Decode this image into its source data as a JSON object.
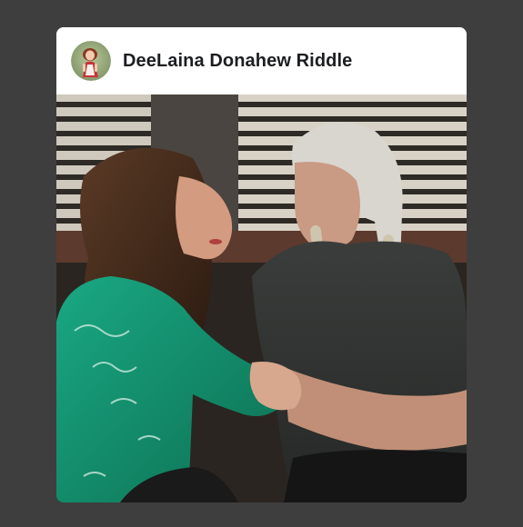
{
  "post": {
    "author_name": "DeeLaina Donahew Riddle",
    "avatar_icon": "profile-avatar-icon",
    "photo_icon": "photo-image"
  }
}
